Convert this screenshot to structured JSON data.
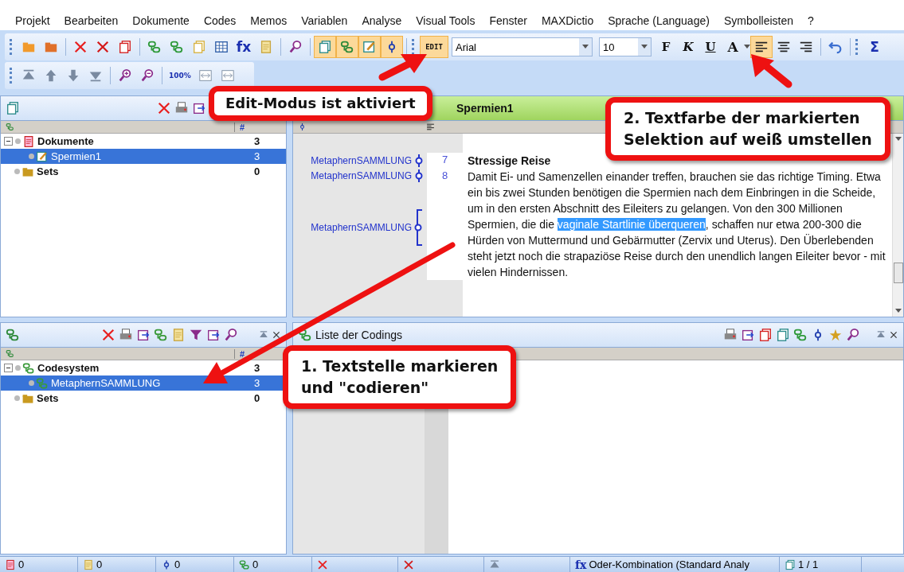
{
  "menu": [
    "Projekt",
    "Bearbeiten",
    "Dokumente",
    "Codes",
    "Memos",
    "Variablen",
    "Analyse",
    "Visual Tools",
    "Fenster",
    "MAXDictio",
    "Sprache (Language)",
    "Symbolleisten",
    "?"
  ],
  "toolbar_1": {
    "groups": [
      [
        {
          "on": false
        },
        {
          "on": false
        }
      ],
      [
        {
          "on": false
        },
        {
          "on": false
        },
        {
          "on": false
        }
      ],
      [
        {
          "on": false
        },
        {
          "on": false
        },
        {
          "on": false
        },
        {
          "on": false
        },
        {
          "label": "fx",
          "on": false
        },
        {
          "on": false
        }
      ],
      [
        {
          "on": false
        }
      ],
      [
        {
          "on": true
        },
        {
          "on": true
        },
        {
          "on": true
        },
        {
          "on": true
        }
      ]
    ],
    "edit_button": {
      "label": "EDIT",
      "on": true
    },
    "font": {
      "value": "Arial"
    },
    "size": {
      "value": "10"
    },
    "format": [
      {
        "label": "F",
        "on": false
      },
      {
        "label": "K",
        "on": false
      },
      {
        "label": "U",
        "on": false
      },
      {
        "label": "A",
        "on": false
      }
    ],
    "align": [
      {
        "on": true
      },
      {
        "on": false
      },
      {
        "on": false
      }
    ],
    "end": [
      {
        "on": false
      },
      {
        "label": "Σ",
        "on": false
      }
    ]
  },
  "toolbar_2": {
    "groups": [
      [
        {
          "on": false
        },
        {
          "on": false
        },
        {
          "on": false
        },
        {
          "on": false
        }
      ],
      [
        {
          "on": false
        },
        {
          "on": false
        }
      ],
      [
        {
          "label": "100%",
          "on": false
        },
        {
          "on": false
        },
        {
          "on": false
        }
      ]
    ]
  },
  "document_browser": {
    "column_label": "#",
    "tree": [
      {
        "name": "Dokumente",
        "kind": "group",
        "count": "3",
        "expanded": true,
        "selected": false,
        "children": [
          {
            "name": "Spermien1",
            "kind": "document",
            "count": "3",
            "selected": true
          }
        ]
      },
      {
        "name": "Sets",
        "kind": "set",
        "count": "0",
        "selected": false
      }
    ]
  },
  "document_viewer": {
    "title": "Spermien1",
    "codings": [
      {
        "code": "MetaphernSAMMLUNG",
        "kind": "point"
      },
      {
        "code": "MetaphernSAMMLUNG",
        "kind": "point"
      },
      {
        "code": "MetaphernSAMMLUNG",
        "kind": "bracket"
      }
    ],
    "paragraphs": [
      {
        "number": "7",
        "heading": true,
        "segments": [
          {
            "text": "Stressige Reise",
            "selected": false
          }
        ]
      },
      {
        "number": "8",
        "heading": false,
        "segments": [
          {
            "text": "Damit Ei- und Samenzellen einander treffen, brauchen sie das richtige Timing. Etwa ein bis zwei Stunden benötigen die Spermien nach dem Einbringen in die Scheide, um in den ersten Abschnitt des Eileiters zu gelangen. Von den 300 Millionen Spermien, die die ",
            "selected": false
          },
          {
            "text": "vaginale Startlinie überqueren",
            "selected": true
          },
          {
            "text": ", schaffen nur etwa 200-300 die Hürden von Muttermund und Gebärmutter (Zervix und Uterus). Den Überlebenden steht jetzt noch die strapaziöse Reise durch den unendlich langen Eileiter bevor - mit vielen Hindernissen.",
            "selected": false
          }
        ]
      }
    ]
  },
  "code_system": {
    "column_label": "#",
    "tree": [
      {
        "name": "Codesystem",
        "kind": "codesystem",
        "count": "3",
        "expanded": true,
        "selected": false,
        "children": [
          {
            "name": "MetaphernSAMMLUNG",
            "kind": "code",
            "count": "3",
            "selected": true
          }
        ]
      },
      {
        "name": "Sets",
        "kind": "set",
        "count": "0",
        "selected": false
      }
    ]
  },
  "retrieved_segments": {
    "title": "Liste der Codings"
  },
  "status_bar": {
    "counts": [
      {
        "text": "0"
      },
      {
        "text": "0"
      },
      {
        "text": "0"
      },
      {
        "text": "0"
      }
    ],
    "filter": {
      "label": "fx",
      "text": "Oder-Kombination (Standard Analy"
    },
    "page": {
      "text": "1 / 1"
    }
  },
  "callouts": [
    {
      "lines": [
        "Edit-Modus ist aktiviert"
      ]
    },
    {
      "lines": [
        "2. Textfarbe der markierten",
        "Selektion auf weiß umstellen"
      ]
    },
    {
      "lines": [
        "1. Textstelle markieren",
        "und \"codieren\""
      ]
    }
  ]
}
